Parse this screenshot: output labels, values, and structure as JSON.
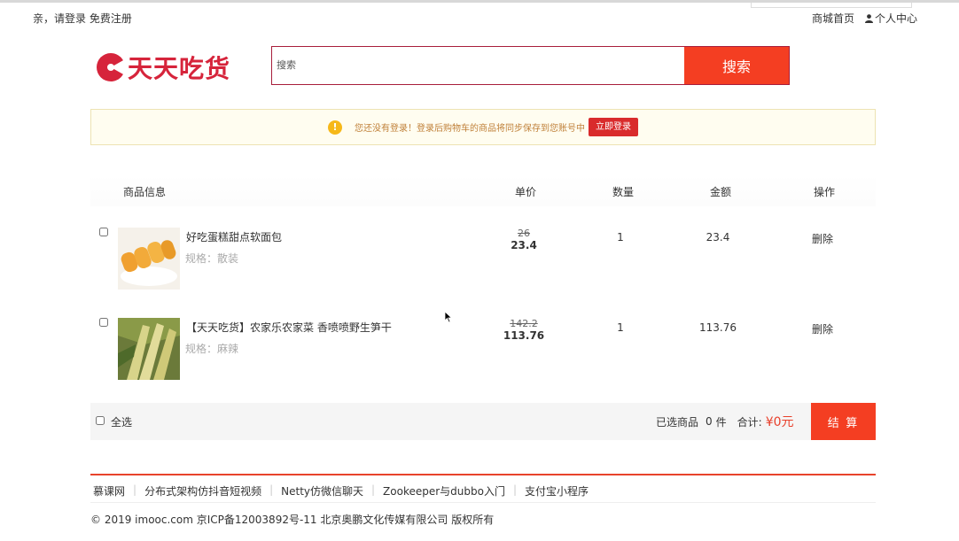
{
  "top_bar": {
    "greeting": "亲，请登录",
    "register": "免费注册",
    "home": "商城首页",
    "user_center": "个人中心"
  },
  "logo": {
    "text": "天天吃货"
  },
  "search": {
    "placeholder": "搜索",
    "button": "搜索"
  },
  "notice": {
    "message": "您还没有登录！登录后购物车的商品将同步保存到您账号中",
    "login_button": "立即登录"
  },
  "cart": {
    "headers": {
      "info": "商品信息",
      "unit_price": "单价",
      "quantity": "数量",
      "amount": "金额",
      "action": "操作"
    },
    "items": [
      {
        "name": "好吃蛋糕甜点软面包",
        "spec": "规格：散装",
        "old_price": "26",
        "price": "23.4",
        "quantity": "1",
        "amount": "23.4",
        "delete": "删除",
        "checked": false
      },
      {
        "name": "【天天吃货】农家乐农家菜 香喷喷野生笋干",
        "spec": "规格：麻辣",
        "old_price": "142.2",
        "price": "113.76",
        "quantity": "1",
        "amount": "113.76",
        "delete": "删除",
        "checked": false
      }
    ]
  },
  "summary": {
    "select_all": "全选",
    "selected_label": "已选商品",
    "selected_count": "0",
    "unit": "件",
    "total_label": "合计:",
    "total_value": "¥0元",
    "checkout": "结 算"
  },
  "footer": {
    "links": [
      "慕课网",
      "分布式架构仿抖音短视频",
      "Netty仿微信聊天",
      "Zookeeper与dubbo入门",
      "支付宝小程序"
    ],
    "copyright": "© 2019 imooc.com 京ICP备12003892号-11 北京奥鹏文化传媒有限公司 版权所有"
  },
  "colors": {
    "accent": "#f43e22",
    "brand": "#d6243b",
    "search_border": "#a81e3b",
    "notice_bg": "#fffdf0",
    "price_total": "#e8402b"
  }
}
